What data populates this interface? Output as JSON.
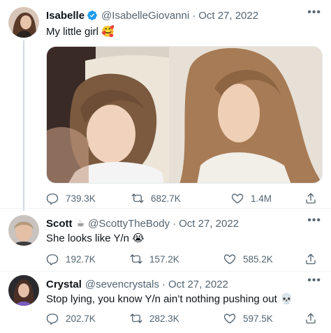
{
  "tweets": [
    {
      "name": "Isabelle",
      "handle": "@IsabelleGiovanni",
      "separator": "·",
      "date": "Oct 27, 2022",
      "text": "My little girl 🥰",
      "verified": true,
      "stats": {
        "replies": "739.3K",
        "retweets": "682.7K",
        "likes": "1.4M"
      }
    },
    {
      "name": "Scott",
      "name_emoji": "☕",
      "handle": "@ScottyTheBody",
      "separator": "·",
      "date": "Oct 27, 2022",
      "text": "She looks like Y/n 😭",
      "stats": {
        "replies": "192.7K",
        "retweets": "157.2K",
        "likes": "585.2K"
      }
    },
    {
      "name": "Crystal",
      "handle": "@sevencrystals",
      "separator": "·",
      "date": "Oct 27, 2022",
      "text": "Stop lying, you know Y/n ain’t nothing pushing out 💀",
      "stats": {
        "replies": "202.7K",
        "retweets": "282.3K",
        "likes": "597.5K"
      }
    }
  ],
  "more_glyph": "•••",
  "icons": [
    "verified-badge-icon",
    "reply-icon",
    "retweet-icon",
    "like-icon",
    "share-icon",
    "more-icon"
  ],
  "colors": {
    "verified": "#1d9bf0",
    "secondary_text": "#536471",
    "thread_line": "#cfd9de"
  }
}
